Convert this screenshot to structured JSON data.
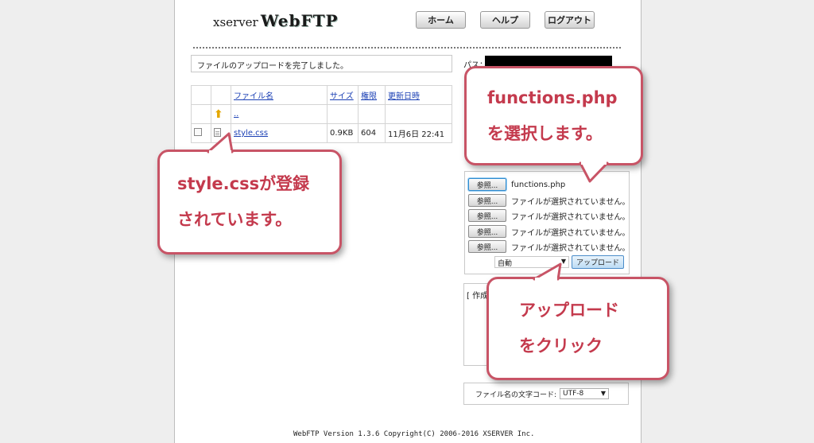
{
  "header": {
    "logo_prefix": "xserver",
    "logo_main": "WebFTP",
    "buttons": {
      "home": "ホーム",
      "help": "ヘルプ",
      "logout": "ログアウト"
    }
  },
  "message": "ファイルのアップロードを完了しました。",
  "path": {
    "label": "パス：",
    "value_redacted": true
  },
  "file_table": {
    "headers": {
      "name": "ファイル名",
      "size": "サイズ",
      "perm": "権限",
      "modified": "更新日時"
    },
    "parent_link": "..",
    "rows": [
      {
        "name": "style.css",
        "size": "0.9KB",
        "perm": "604",
        "modified": "11月6日 22:41"
      }
    ]
  },
  "upload": {
    "browse_label": "参照...",
    "files": [
      "functions.php",
      "ファイルが選択されていません。",
      "ファイルが選択されていません。",
      "ファイルが選択されていません。",
      "ファイルが選択されていません。"
    ],
    "encoding": "自動",
    "submit": "アップロード"
  },
  "make_panel_label": "[ 作成",
  "filename_encoding": {
    "label": "ファイル名の文字コード:",
    "value": "UTF-8"
  },
  "footer": "WebFTP Version 1.3.6   Copyright(C) 2006-2016 XSERVER Inc.",
  "callouts": {
    "select": [
      "functions.php",
      "を選択します。"
    ],
    "registered": [
      "style.cssが登録",
      "されています。"
    ],
    "click": [
      "アップロード",
      "をクリック"
    ]
  },
  "colors": {
    "callout_border": "#c85466",
    "callout_text": "#c43a4d",
    "link": "#1a3fb4"
  },
  "icons": {
    "parent_dir": "up-arrow-folder-icon",
    "file": "document-icon"
  }
}
